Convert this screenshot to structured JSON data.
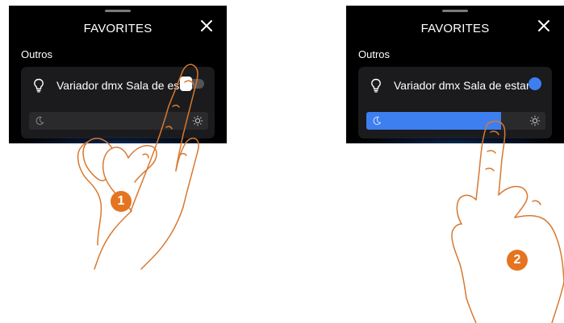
{
  "colors": {
    "accent_blue": "#3d7ff0",
    "step_orange": "#e57420",
    "hand_outline": "#d9782f",
    "screen_bg": "#000000",
    "card_bg": "#1b1b1d"
  },
  "panels": [
    {
      "header": {
        "title": "FAVORITES",
        "close_icon": "close-icon"
      },
      "section": "Outros",
      "device": {
        "icon": "lightbulb-icon",
        "name": "Variador dmx Sala de estar",
        "toggle_on": false
      },
      "dimmer": {
        "level": 0,
        "min_icon": "moon-icon",
        "max_icon": "sun-icon"
      },
      "step": "1"
    },
    {
      "header": {
        "title": "FAVORITES",
        "close_icon": "close-icon"
      },
      "section": "Outros",
      "device": {
        "icon": "lightbulb-icon",
        "name": "Variador dmx Sala de estar",
        "toggle_on": true
      },
      "dimmer": {
        "level": 0.75,
        "min_icon": "moon-icon",
        "max_icon": "sun-icon"
      },
      "step": "2"
    }
  ]
}
